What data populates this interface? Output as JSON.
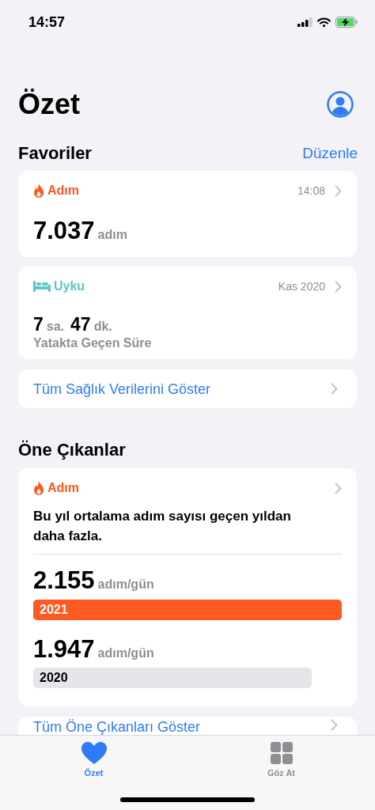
{
  "status_bar": {
    "time": "14:57"
  },
  "title": "Özet",
  "favorites": {
    "heading": "Favoriler",
    "edit": "Düzenle",
    "cards": [
      {
        "kind": "steps",
        "category": "Adım",
        "time": "14:08",
        "value": "7.037",
        "unit": "adım"
      },
      {
        "kind": "sleep",
        "category": "Uyku",
        "time": "Kas 2020",
        "hours": "7",
        "hours_unit": "sa.",
        "minutes": "47",
        "minutes_unit": "dk.",
        "caption": "Yatakta Geçen Süre"
      }
    ],
    "show_all": "Tüm Sağlık Verilerini Göster"
  },
  "highlights": {
    "heading": "Öne Çıkanlar",
    "category": "Adım",
    "summary": "Bu yıl ortalama adım sayısı geçen yıldan daha fazla.",
    "bars": [
      {
        "value": "2.155",
        "unit": "adım/gün",
        "year": "2021",
        "current": true
      },
      {
        "value": "1.947",
        "unit": "adım/gün",
        "year": "2020",
        "current": false
      }
    ],
    "show_all": "Tüm Öne Çıkanları Göster"
  },
  "tab_bar": [
    {
      "label": "Özet",
      "selected": true
    },
    {
      "label": "Göz At",
      "selected": false
    }
  ]
}
